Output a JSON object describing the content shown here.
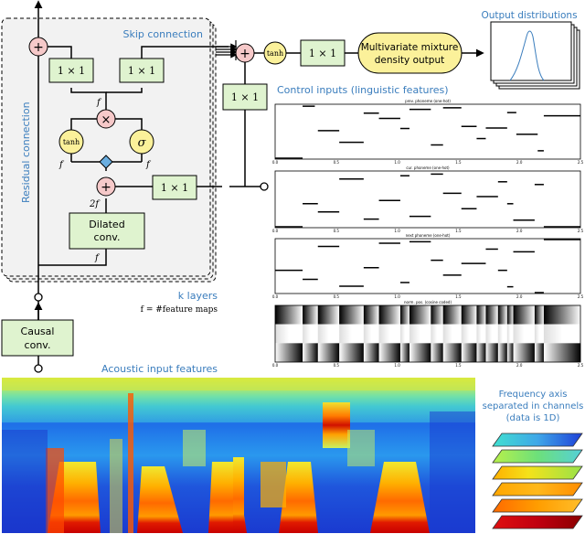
{
  "diagram": {
    "labels": {
      "skip_connection": "Skip connection",
      "residual_connection": "Residual connection",
      "k_layers": "k layers",
      "f_def": "f = #feature maps",
      "causal_conv": [
        "Causal",
        "conv."
      ],
      "dilated_conv": [
        "Dilated",
        "conv."
      ],
      "acoustic_input": "Acoustic input features",
      "control_inputs": "Control inputs (linguistic features)",
      "output_distributions": "Output distributions",
      "mixture_output": [
        "Multivariate mixture",
        "density output"
      ],
      "freq_axis": [
        "Frequency axis",
        "separated in channels",
        "(data is 1D)"
      ]
    },
    "ops": {
      "one_by_one": "1 × 1",
      "tanh": "tanh",
      "sigma": "σ",
      "plus": "+",
      "times": "×",
      "f": "f",
      "two_f": "2f"
    },
    "control_panels": [
      {
        "title": "prev. phoneme (one-hot)"
      },
      {
        "title": "cur. phoneme (one-hot)"
      },
      {
        "title": "next phoneme (one-hot)"
      },
      {
        "title": "norm. pos. (cosine coded)"
      }
    ],
    "tick_labels": [
      "0.0",
      "0.5",
      "1.0",
      "1.5",
      "2.0",
      "2.5"
    ],
    "colors": {
      "green_box": "#dff3cf",
      "yellow_node": "#fbf19a",
      "pink_node": "#f6c9c9",
      "diamond": "#6aaee0",
      "accent_blue": "#3a7dbd",
      "layer_bg": "#f2f2f2"
    }
  },
  "chart_data": [
    {
      "type": "scatter",
      "title": "prev. phoneme (one-hot)",
      "segments": [
        [
          0,
          0.09,
          0.0
        ],
        [
          0.09,
          0.13,
          0.98
        ],
        [
          0.14,
          0.21,
          0.52
        ],
        [
          0.21,
          0.29,
          0.3
        ],
        [
          0.29,
          0.34,
          0.85
        ],
        [
          0.34,
          0.41,
          0.75
        ],
        [
          0.41,
          0.44,
          0.56
        ],
        [
          0.44,
          0.51,
          0.92
        ],
        [
          0.51,
          0.55,
          0.25
        ],
        [
          0.55,
          0.61,
          0.95
        ],
        [
          0.61,
          0.66,
          0.6
        ],
        [
          0.66,
          0.69,
          0.37
        ],
        [
          0.69,
          0.76,
          0.57
        ],
        [
          0.76,
          0.79,
          0.86
        ],
        [
          0.79,
          0.86,
          0.45
        ],
        [
          0.86,
          0.88,
          0.14
        ],
        [
          0.88,
          1.0,
          0.8
        ]
      ]
    },
    {
      "type": "scatter",
      "title": "cur. phoneme (one-hot)",
      "segments": [
        [
          0,
          0.09,
          0.0
        ],
        [
          0.09,
          0.14,
          0.42
        ],
        [
          0.14,
          0.21,
          0.27
        ],
        [
          0.21,
          0.29,
          0.87
        ],
        [
          0.29,
          0.34,
          0.14
        ],
        [
          0.34,
          0.41,
          0.48
        ],
        [
          0.41,
          0.44,
          0.93
        ],
        [
          0.44,
          0.51,
          0.19
        ],
        [
          0.51,
          0.55,
          0.96
        ],
        [
          0.55,
          0.61,
          0.61
        ],
        [
          0.61,
          0.66,
          0.33
        ],
        [
          0.66,
          0.73,
          0.55
        ],
        [
          0.73,
          0.76,
          0.82
        ],
        [
          0.76,
          0.78,
          0.42
        ],
        [
          0.78,
          0.85,
          0.12
        ],
        [
          0.85,
          0.88,
          0.77
        ],
        [
          0.88,
          1.0,
          0.0
        ]
      ]
    },
    {
      "type": "scatter",
      "title": "next phoneme (one-hot)",
      "segments": [
        [
          0,
          0.09,
          0.42
        ],
        [
          0.09,
          0.14,
          0.25
        ],
        [
          0.14,
          0.21,
          0.87
        ],
        [
          0.21,
          0.29,
          0.12
        ],
        [
          0.29,
          0.34,
          0.47
        ],
        [
          0.34,
          0.41,
          0.93
        ],
        [
          0.41,
          0.44,
          0.19
        ],
        [
          0.44,
          0.51,
          0.96
        ],
        [
          0.51,
          0.55,
          0.61
        ],
        [
          0.55,
          0.61,
          0.33
        ],
        [
          0.61,
          0.69,
          0.55
        ],
        [
          0.69,
          0.73,
          0.82
        ],
        [
          0.73,
          0.76,
          0.42
        ],
        [
          0.76,
          0.78,
          0.11
        ],
        [
          0.78,
          0.85,
          0.77
        ],
        [
          0.85,
          0.88,
          0.0
        ],
        [
          0.88,
          1.0,
          1.0
        ]
      ]
    },
    {
      "type": "heatmap",
      "title": "norm. pos. (cosine coded)",
      "boundaries": [
        0,
        0.09,
        0.14,
        0.21,
        0.29,
        0.34,
        0.41,
        0.44,
        0.51,
        0.55,
        0.61,
        0.66,
        0.69,
        0.73,
        0.76,
        0.78,
        0.85,
        0.88,
        1.0
      ],
      "rows": 3
    }
  ]
}
